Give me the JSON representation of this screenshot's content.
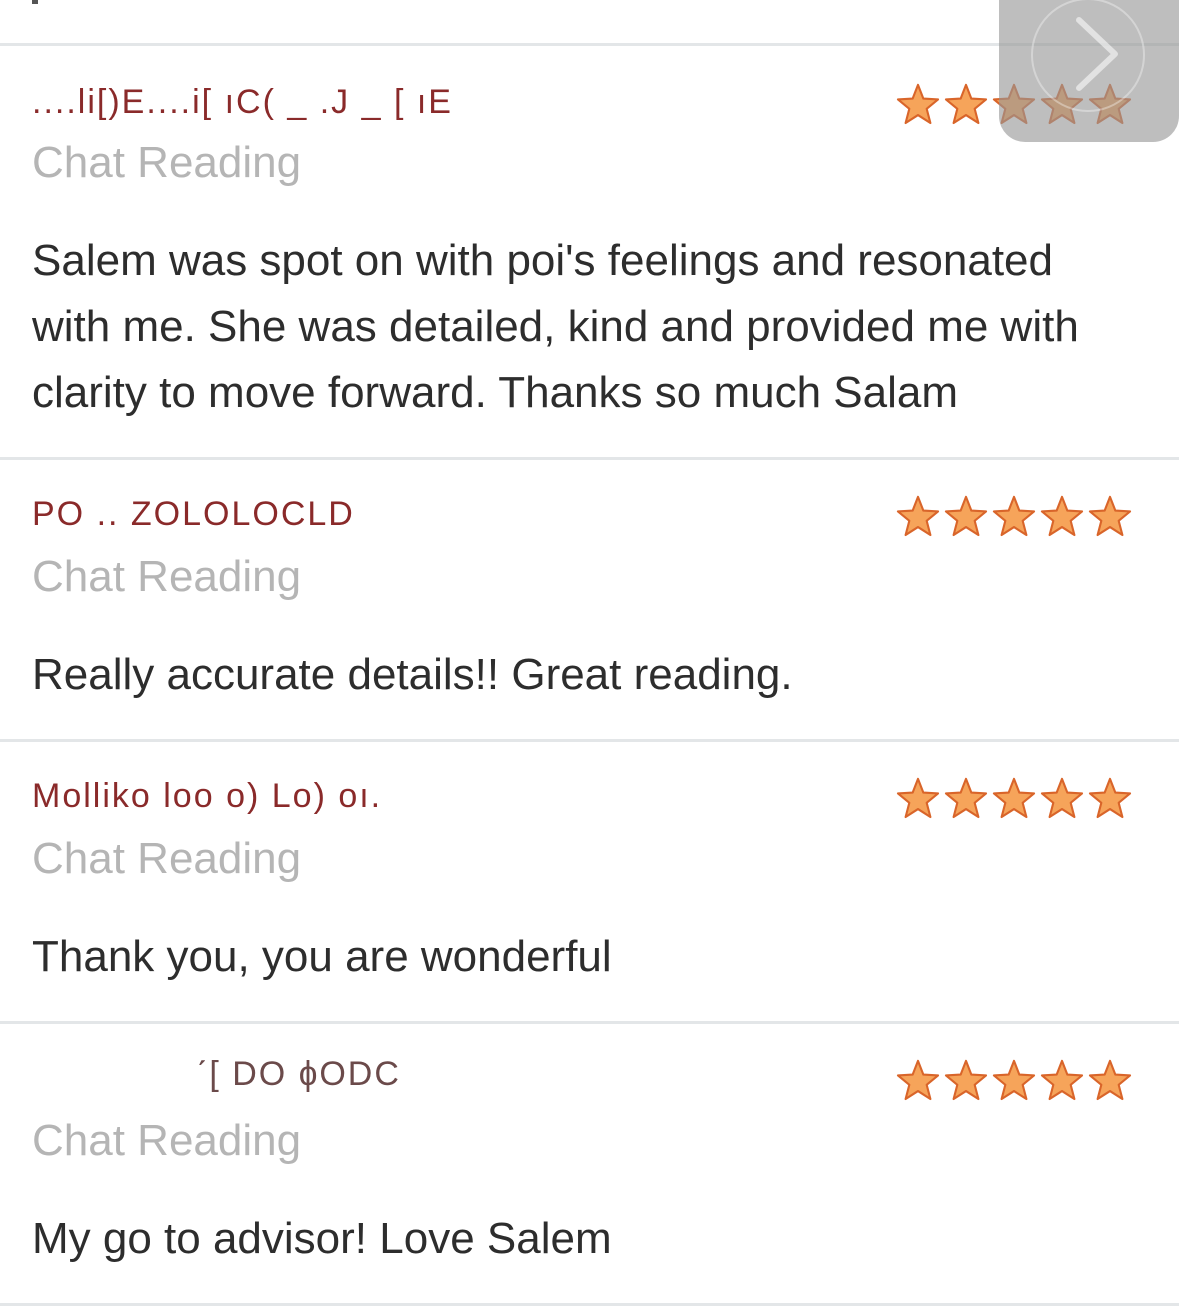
{
  "reviews": [
    {
      "reviewer": "....li[)E....i[ ıC( _ .J _ [ ıE",
      "reading_type": "Chat Reading",
      "rating": 5,
      "comment": "Salem was spot on with poi's feelings and resonated with me. She was detailed, kind and provided me with clarity to move forward. Thanks so much Salam"
    },
    {
      "reviewer": "PO .. ZOLOLOCLD",
      "reading_type": "Chat Reading",
      "rating": 5,
      "comment": "Really accurate details!! Great reading."
    },
    {
      "reviewer": "Molliko loo o) Lo) oı.",
      "reading_type": "Chat Reading",
      "rating": 5,
      "comment": "Thank you, you are wonderful"
    },
    {
      "reviewer": "ˊ[ DO ɸODC",
      "reading_type": "Chat Reading",
      "rating": 5,
      "comment": "My go to advisor! Love Salem"
    }
  ],
  "colors": {
    "star_fill": "#f6a45a",
    "star_stroke": "#d9652a",
    "reading_type": "#b5b5b5",
    "divider": "#e3e6e8"
  },
  "icons": {
    "next": "chevron-right-icon",
    "star": "star-icon"
  }
}
